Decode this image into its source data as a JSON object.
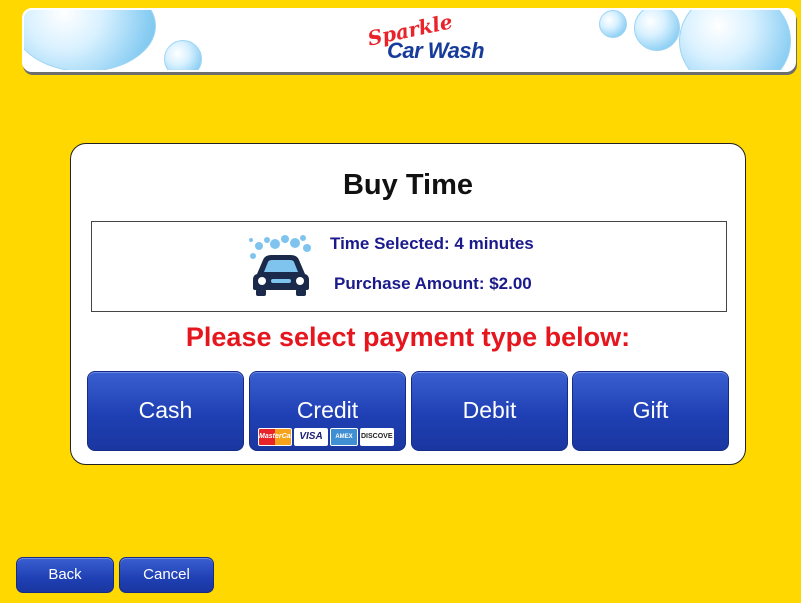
{
  "brand": {
    "logo_top": "Sparkle",
    "logo_bottom": "Car Wash"
  },
  "page": {
    "title": "Buy Time"
  },
  "summary": {
    "time_selected": "Time Selected: 4 minutes",
    "purchase_amount": "Purchase Amount: $2.00",
    "icon": "car-wash-icon"
  },
  "prompt": "Please select payment type below:",
  "payment_options": [
    {
      "label": "Cash"
    },
    {
      "label": "Credit",
      "cards": [
        "MasterCard",
        "VISA",
        "AMEX",
        "DISCOVER"
      ]
    },
    {
      "label": "Debit"
    },
    {
      "label": "Gift"
    }
  ],
  "nav": {
    "back": "Back",
    "cancel": "Cancel"
  },
  "colors": {
    "background": "#ffd800",
    "button_blue": "#1f40b4",
    "prompt_red": "#e5161d",
    "info_text": "#1a1a8c"
  }
}
